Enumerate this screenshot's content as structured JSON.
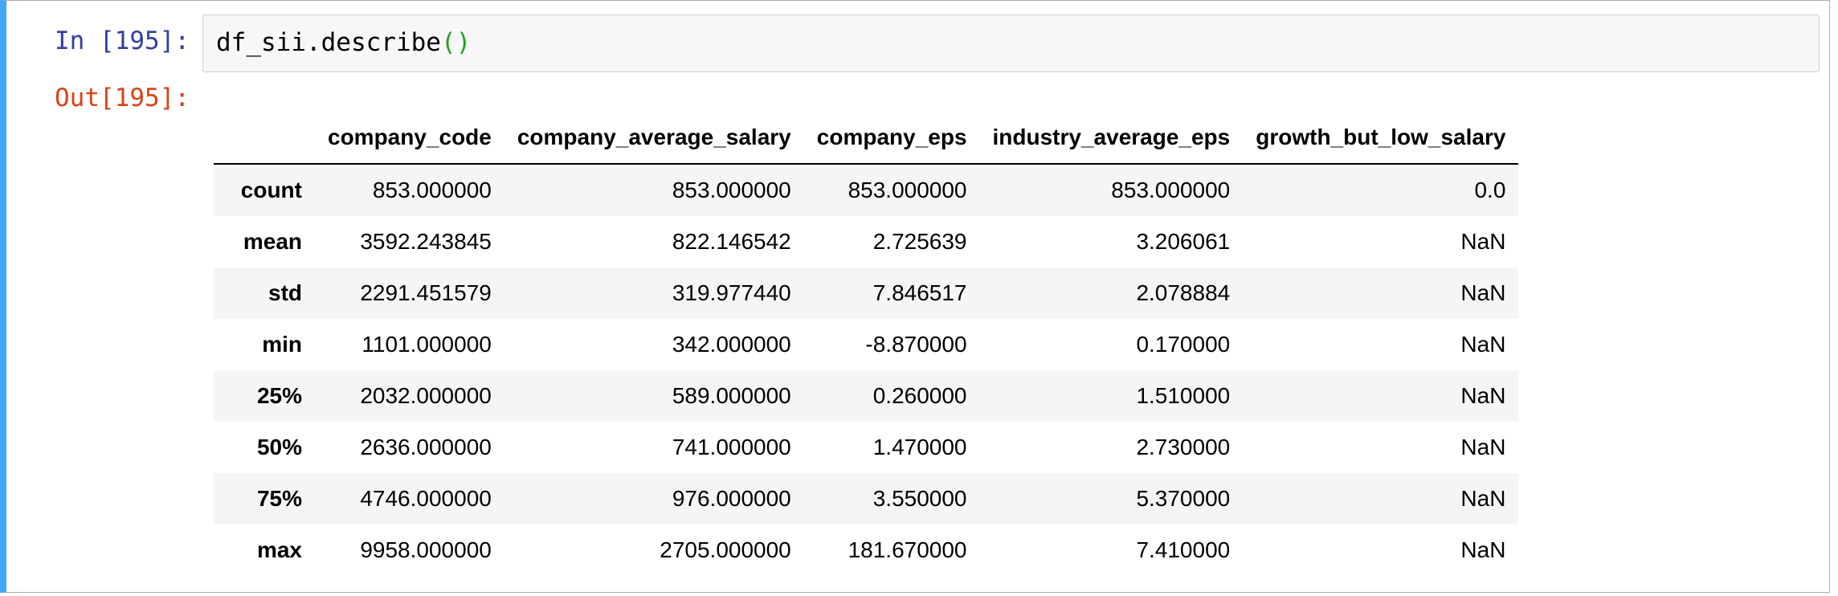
{
  "cell": {
    "in_prompt": "In [195]:",
    "out_prompt": "Out[195]:",
    "code": {
      "text": "df_sii.describe",
      "open_paren": "(",
      "close_paren": ")"
    }
  },
  "table": {
    "index_header": "",
    "columns": [
      "company_code",
      "company_average_salary",
      "company_eps",
      "industry_average_eps",
      "growth_but_low_salary"
    ],
    "rows": [
      {
        "label": "count",
        "values": [
          "853.000000",
          "853.000000",
          "853.000000",
          "853.000000",
          "0.0"
        ]
      },
      {
        "label": "mean",
        "values": [
          "3592.243845",
          "822.146542",
          "2.725639",
          "3.206061",
          "NaN"
        ]
      },
      {
        "label": "std",
        "values": [
          "2291.451579",
          "319.977440",
          "7.846517",
          "2.078884",
          "NaN"
        ]
      },
      {
        "label": "min",
        "values": [
          "1101.000000",
          "342.000000",
          "-8.870000",
          "0.170000",
          "NaN"
        ]
      },
      {
        "label": "25%",
        "values": [
          "2032.000000",
          "589.000000",
          "0.260000",
          "1.510000",
          "NaN"
        ]
      },
      {
        "label": "50%",
        "values": [
          "2636.000000",
          "741.000000",
          "1.470000",
          "2.730000",
          "NaN"
        ]
      },
      {
        "label": "75%",
        "values": [
          "4746.000000",
          "976.000000",
          "3.550000",
          "5.370000",
          "NaN"
        ]
      },
      {
        "label": "max",
        "values": [
          "9958.000000",
          "2705.000000",
          "181.670000",
          "7.410000",
          "NaN"
        ]
      }
    ]
  },
  "colors": {
    "cell_selected_border": "#42a5f5",
    "in_prompt": "#303f9f",
    "out_prompt": "#d84315",
    "paren": "#22a022",
    "code_bg": "#f7f7f7",
    "row_stripe": "#f5f5f5"
  }
}
